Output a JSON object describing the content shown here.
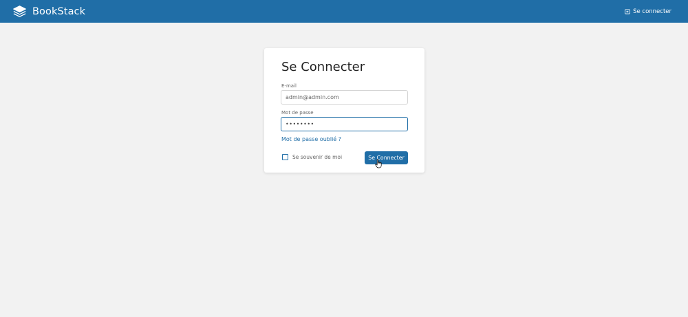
{
  "header": {
    "brand_name": "BookStack",
    "login_label": "Se connecter",
    "brand_color": "#206ea7"
  },
  "login": {
    "title": "Se Connecter",
    "email": {
      "label": "E-mail",
      "value": "admin@admin.com"
    },
    "password": {
      "label": "Mot de passe",
      "value": "••••••••"
    },
    "forgot_link": "Mot de passe oublié ?",
    "remember_label": "Se souvenir de moi",
    "remember_checked": false,
    "submit_label": "Se Connecter"
  },
  "icons": {
    "brand": "bookstack-logo-icon",
    "login": "login-icon",
    "cursor": "hand-pointer-icon"
  }
}
